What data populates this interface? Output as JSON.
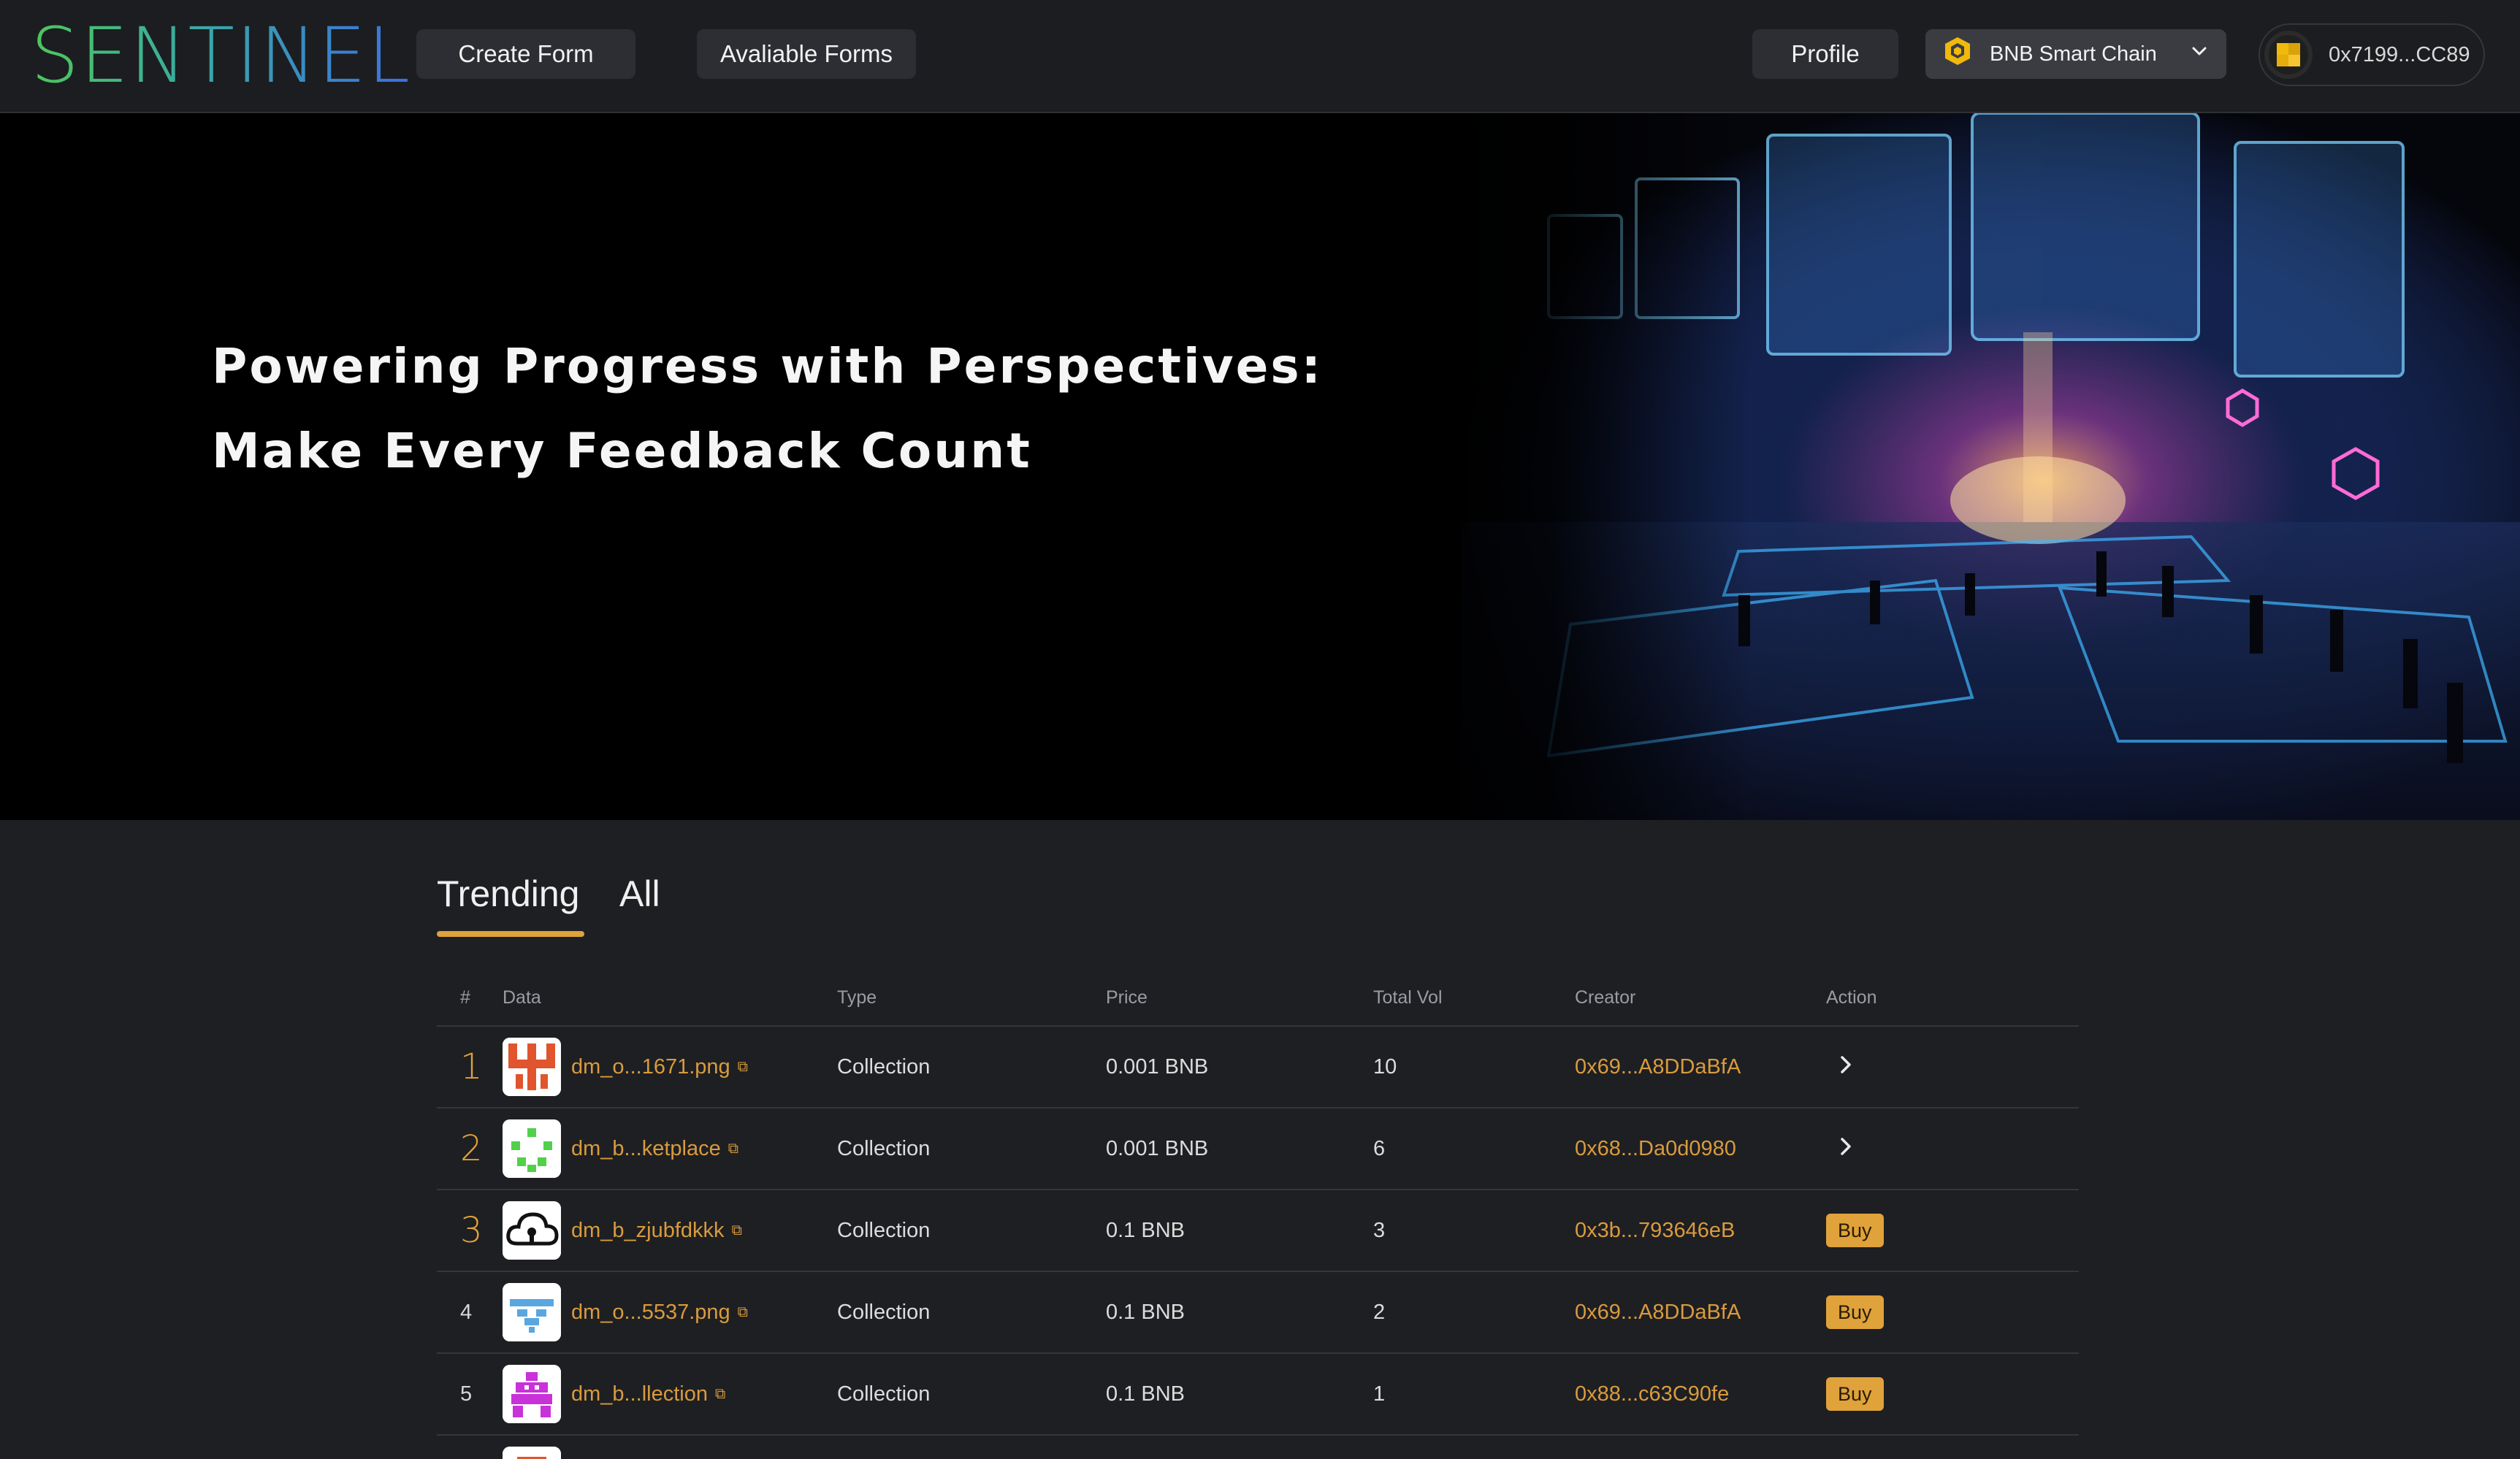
{
  "brand": {
    "name": "SENTINEL"
  },
  "nav": {
    "create_form": "Create Form",
    "available_forms": "Avaliable Forms",
    "profile": "Profile",
    "chain": "BNB Smart Chain",
    "wallet_address": "0x7199...CC89"
  },
  "hero": {
    "line1": "Powering Progress with Perspectives:",
    "line2": "Make Every Feedback Count"
  },
  "tabs": [
    {
      "label": "Trending",
      "active": true
    },
    {
      "label": "All",
      "active": false
    }
  ],
  "table": {
    "headers": {
      "rank": "#",
      "data": "Data",
      "type": "Type",
      "price": "Price",
      "total_vol": "Total Vol",
      "creator": "Creator",
      "action": "Action"
    },
    "rows": [
      {
        "rank": "1",
        "name": "dm_o...1671.png",
        "type": "Collection",
        "price": "0.001 BNB",
        "vol": "10",
        "creator": "0x69...A8DDaBfA",
        "action": "chevron"
      },
      {
        "rank": "2",
        "name": "dm_b...ketplace",
        "type": "Collection",
        "price": "0.001 BNB",
        "vol": "6",
        "creator": "0x68...Da0d0980",
        "action": "chevron"
      },
      {
        "rank": "3",
        "name": "dm_b_zjubfdkkk",
        "type": "Collection",
        "price": "0.1 BNB",
        "vol": "3",
        "creator": "0x3b...793646eB",
        "action": "Buy"
      },
      {
        "rank": "4",
        "name": "dm_o...5537.png",
        "type": "Collection",
        "price": "0.1 BNB",
        "vol": "2",
        "creator": "0x69...A8DDaBfA",
        "action": "Buy"
      },
      {
        "rank": "5",
        "name": "dm_b...llection",
        "type": "Collection",
        "price": "0.1 BNB",
        "vol": "1",
        "creator": "0x88...c63C90fe",
        "action": "Buy"
      }
    ]
  },
  "colors": {
    "accent": "#e0a23a",
    "background": "#1e1f22",
    "header_bg": "#1c1d20",
    "button_bg": "#2c2e33"
  },
  "icons": {
    "chain": "bnb-logo-icon",
    "dropdown": "chevron-down-icon",
    "external": "external-link-icon",
    "row_action": "chevron-right-icon"
  }
}
